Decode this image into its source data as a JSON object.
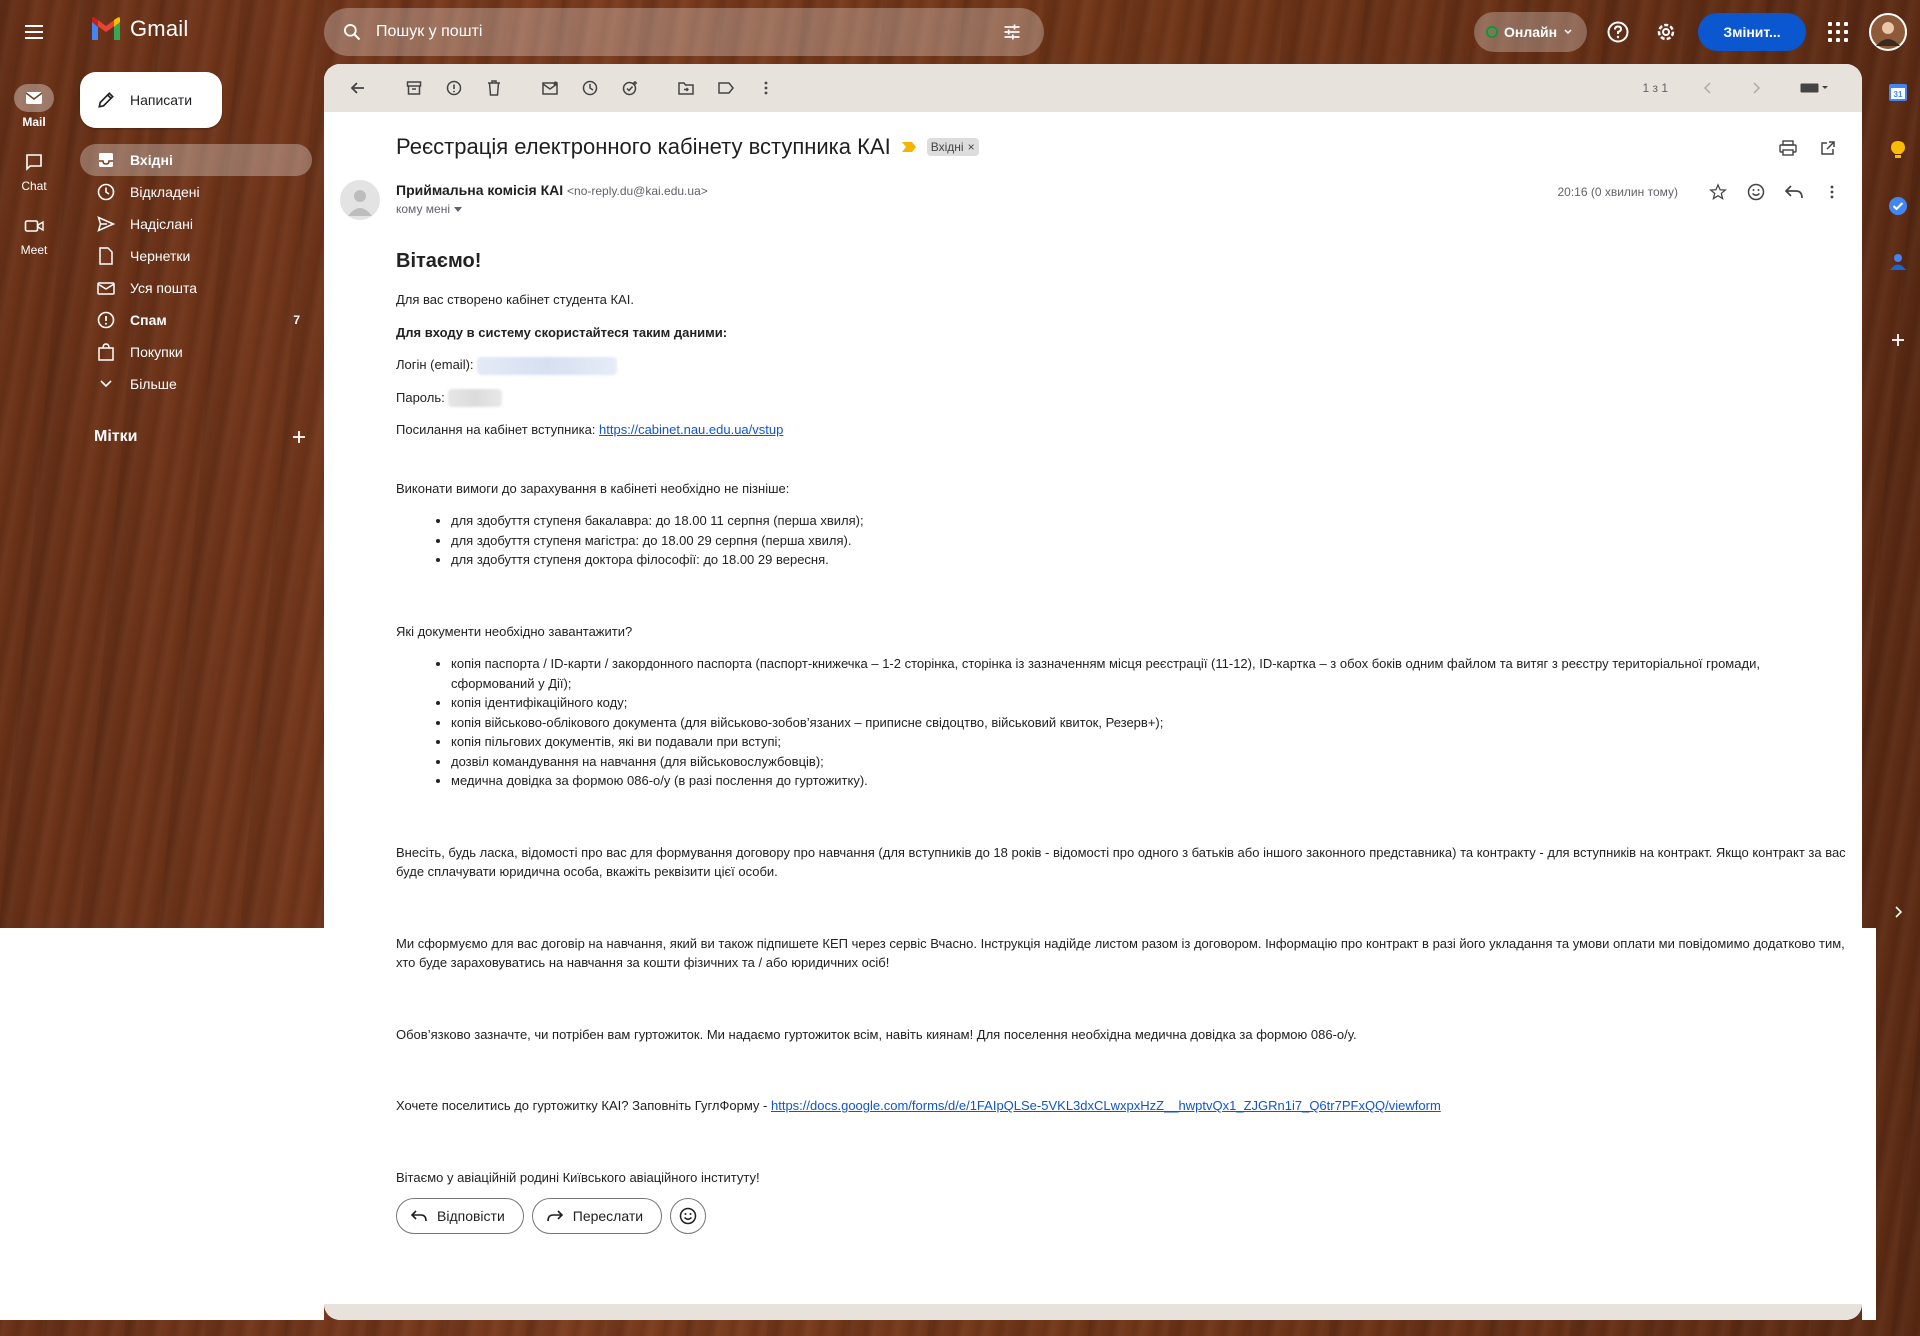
{
  "app": {
    "name": "Gmail"
  },
  "search": {
    "placeholder": "Пошук у пошті"
  },
  "header": {
    "status": "Онлайн",
    "switch_label": "Змінит..."
  },
  "rail": [
    {
      "label": "Mail",
      "icon": "mail-icon"
    },
    {
      "label": "Chat",
      "icon": "chat-icon"
    },
    {
      "label": "Meet",
      "icon": "video-icon"
    }
  ],
  "compose": {
    "label": "Написати"
  },
  "nav": {
    "items": [
      {
        "label": "Вхідні",
        "icon": "inbox-icon"
      },
      {
        "label": "Відкладені",
        "icon": "clock-icon"
      },
      {
        "label": "Надіслані",
        "icon": "send-icon"
      },
      {
        "label": "Чернетки",
        "icon": "draft-icon"
      },
      {
        "label": "Уся пошта",
        "icon": "all-mail-icon"
      },
      {
        "label": "Спам",
        "icon": "spam-icon",
        "count": "7"
      },
      {
        "label": "Покупки",
        "icon": "purchases-icon"
      },
      {
        "label": "Більше",
        "icon": "chevron-down-icon"
      }
    ],
    "labels_heading": "Мітки"
  },
  "toolbar": {
    "pagination": "1 з 1"
  },
  "message": {
    "subject": "Реєстрація електронного кабінету вступника КАІ",
    "label_chip": "Вхідні",
    "sender_name": "Приймальна комісія КАІ",
    "sender_email": "<no-reply.du@kai.edu.ua>",
    "to": "кому мені",
    "time": "20:16 (0 хвилин тому)",
    "greeting": "Вітаємо!",
    "p1": "Для вас створено кабінет студента КАІ.",
    "p2": "Для входу в систему скористайтеся таким даними:",
    "login_label": "Логін (email):",
    "password_label": "Пароль:",
    "cabinet_label": "Посилання на кабінет вступника:",
    "cabinet_link": "https://cabinet.nau.edu.ua/vstup",
    "deadlines_intro": "Виконати вимоги до зарахування в кабінеті необхідно не пізніше:",
    "deadlines": [
      "для здобуття ступеня бакалавра: до 18.00 11 серпня (перша хвиля);",
      "для здобуття ступеня магістра: до 18.00 29 серпня (перша хвиля).",
      "для здобуття ступеня доктора філософії: до 18.00 29 вересня."
    ],
    "docs_intro": "Які документи необхідно завантажити?",
    "docs": [
      "копія паспорта / ID-карти / закордонного паспорта (паспорт-книжечка – 1-2 сторінка, сторінка із зазначенням місця реєстрації (11-12), ID-картка – з обох боків одним файлом та витяг з реєстру територіальної громади, сформований у Дії);",
      "копія ідентифікаційного коду;",
      "копія військово-облікового документа (для військово-зобов’язаних – приписне свідоцтво, військовий квиток, Резерв+);",
      "копія пільгових документів, які ви подавали при вступі;",
      "дозвіл командування на навчання (для військовослужбовців);",
      "медична довідка за формою 086-о/у (в разі послення до гуртожитку)."
    ],
    "p_contract": "Внесіть, будь ласка, відомості про вас для формування договору про навчання (для вступників до 18 років - відомості про одного з батьків або іншого законного представника) та контракту - для вступників на контракт. Якщо контракт за вас буде сплачувати юридична особа, вкажіть реквізити цієї особи.",
    "p_agreement": "Ми сформуємо для вас договір на навчання, який ви також підпишете КЕП через сервіс Вчасно. Інструкція надійде листом разом із договором. Інформацію про контракт в разі його укладання та умови оплати ми повідомимо додатково тим, хто буде зараховуватись на навчання за кошти фізичних та / або юридичних осіб!",
    "p_dorm": "Обов’язково зазначте, чи потрібен вам гуртожиток. Ми надаємо гуртожиток всім, навіть киянам! Для поселення необхідна медична довідка за формою 086-о/у.",
    "form_label": "Хочете поселитись до гуртожитку КАІ? Заповніть ГуглФорму -",
    "form_link": "https://docs.google.com/forms/d/e/1FAIpQLSe-5VKL3dxCLwxpxHzZ__hwptvQx1_ZJGRn1i7_Q6tr7PFxQQ/viewform",
    "closing": "Вітаємо у авіаційній родині Київського авіаційного інституту!"
  },
  "actions": {
    "reply": "Відповісти",
    "forward": "Переслати"
  },
  "side": {
    "calendar_day": "31"
  },
  "colors": {
    "accent": "#0b57d0",
    "link": "#1155cc"
  }
}
